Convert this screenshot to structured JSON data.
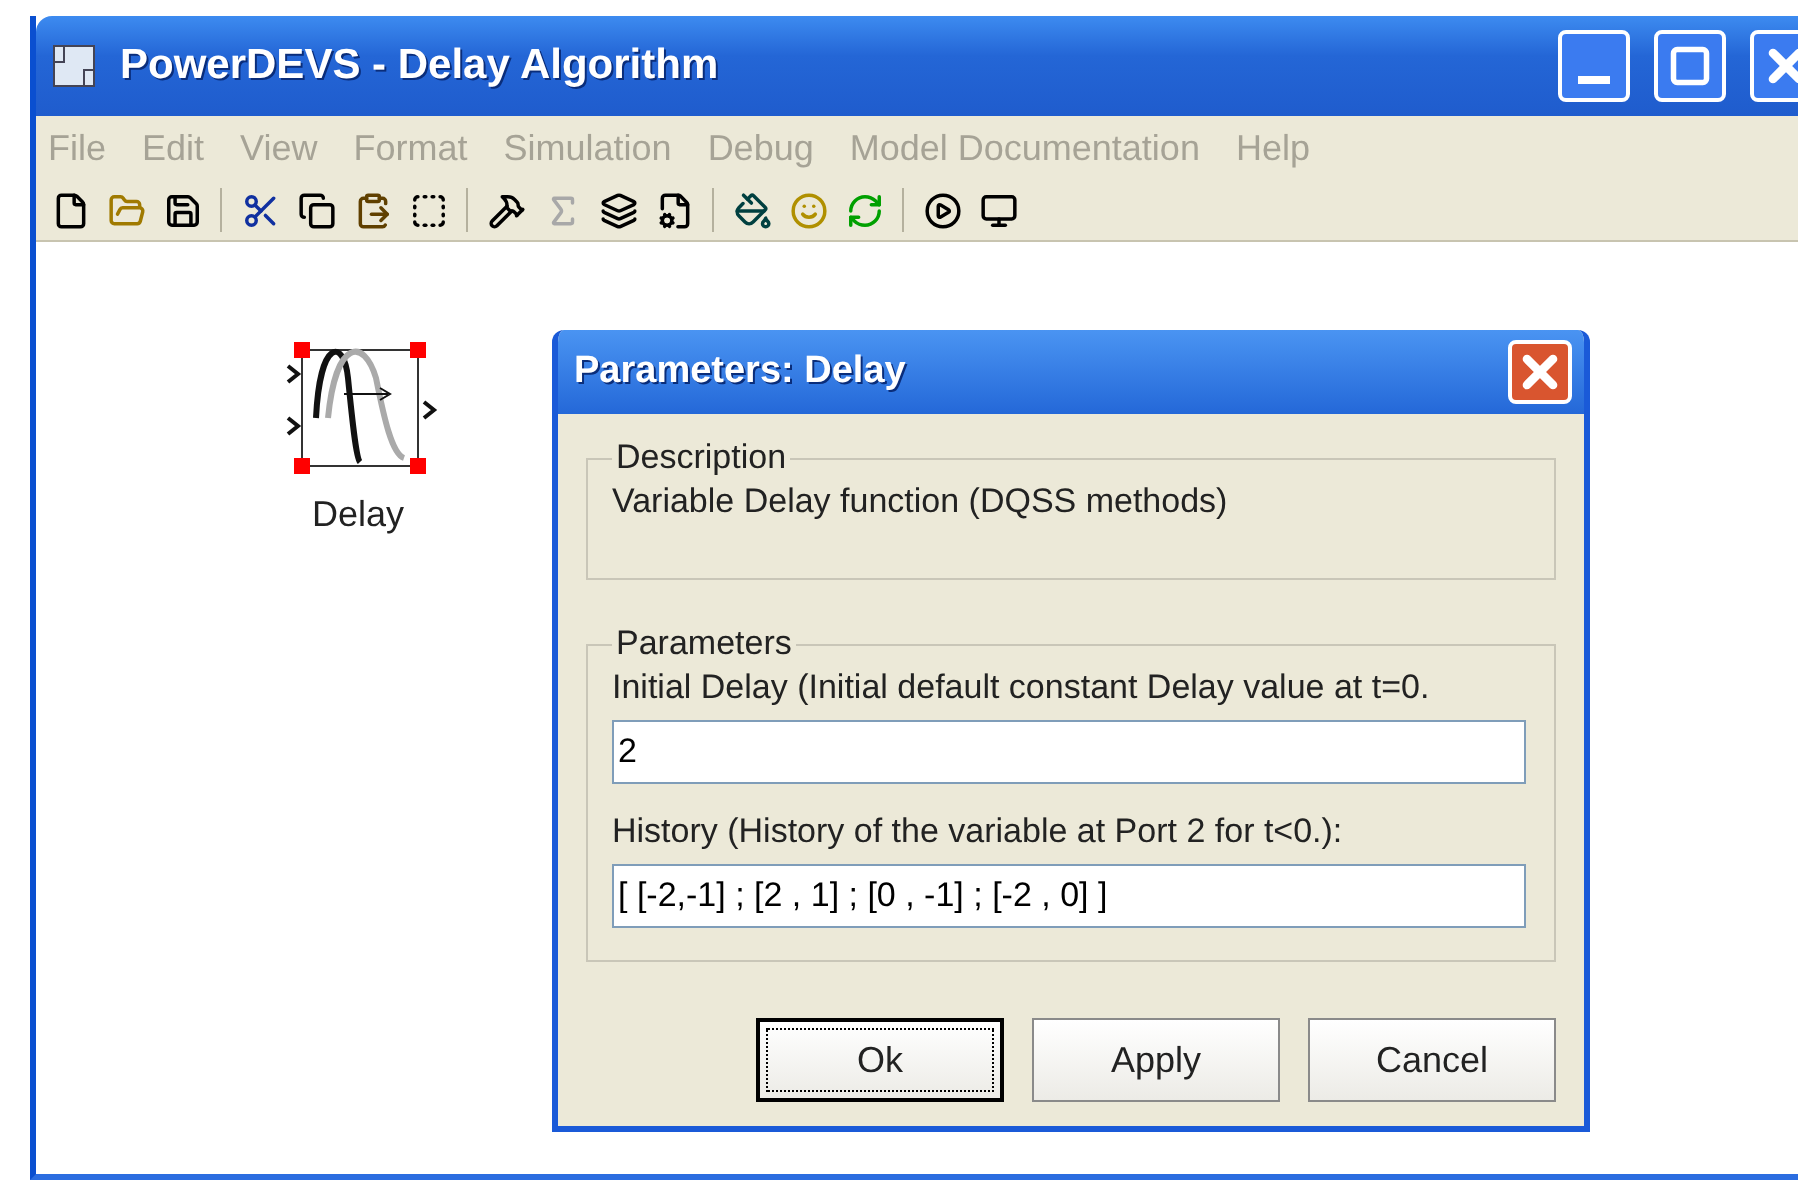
{
  "window": {
    "title": "PowerDEVS - Delay Algorithm"
  },
  "menu": [
    {
      "label": "File",
      "disabled": true
    },
    {
      "label": "Edit",
      "disabled": true
    },
    {
      "label": "View",
      "disabled": true
    },
    {
      "label": "Format",
      "disabled": true
    },
    {
      "label": "Simulation",
      "disabled": true
    },
    {
      "label": "Debug",
      "disabled": true
    },
    {
      "label": "Model Documentation",
      "disabled": true
    },
    {
      "label": "Help",
      "disabled": true
    }
  ],
  "toolbar": [
    [
      {
        "kind": "new",
        "disabled": false
      },
      {
        "kind": "open",
        "disabled": false
      },
      {
        "kind": "save",
        "disabled": false
      }
    ],
    [
      {
        "kind": "cut",
        "disabled": false
      },
      {
        "kind": "copy",
        "disabled": false
      },
      {
        "kind": "paste",
        "disabled": false
      },
      {
        "kind": "select",
        "disabled": false
      }
    ],
    [
      {
        "kind": "tools",
        "disabled": false
      },
      {
        "kind": "sigma",
        "disabled": true
      },
      {
        "kind": "layers",
        "disabled": false
      },
      {
        "kind": "properties",
        "disabled": false
      }
    ],
    [
      {
        "kind": "paint",
        "disabled": false
      },
      {
        "kind": "smiley",
        "disabled": false
      },
      {
        "kind": "refresh",
        "disabled": false
      }
    ],
    [
      {
        "kind": "play",
        "disabled": false
      },
      {
        "kind": "plot",
        "disabled": false
      }
    ]
  ],
  "block": {
    "label": "Delay",
    "selected": true
  },
  "dialog": {
    "title": "Parameters: Delay",
    "description": {
      "legend": "Description",
      "text": "Variable Delay function (DQSS methods)"
    },
    "parameters": {
      "legend": "Parameters",
      "fields": [
        {
          "label": "Initial Delay (Initial default constant Delay value at t=0.",
          "value": "2"
        },
        {
          "label": "History (History of the variable at Port 2 for t<0.):",
          "value": "[ [-2,-1] ; [2 , 1] ; [0 , -1] ; [-2 , 0] ]"
        }
      ]
    },
    "buttons": [
      {
        "label": "Ok",
        "default": true
      },
      {
        "label": "Apply",
        "default": false
      },
      {
        "label": "Cancel",
        "default": false
      }
    ]
  }
}
